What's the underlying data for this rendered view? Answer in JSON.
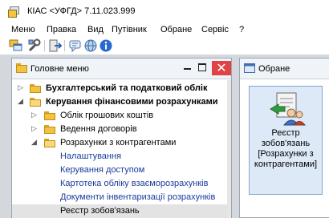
{
  "window": {
    "title": "КІАС <УФГД> 7.11.023.999"
  },
  "menubar": {
    "items": [
      "Меню",
      "Правка",
      "Вид",
      "Путівник",
      "Обране",
      "Сервіс",
      "?"
    ]
  },
  "toolbar": {
    "buttons": [
      "windows-icon",
      "tools-icon",
      "exit-icon",
      "chat-icon",
      "network-icon",
      "info-icon"
    ]
  },
  "main_menu_window": {
    "title": "Головне меню",
    "close_symbol": "✕",
    "tree": [
      {
        "label": "Бухгалтерський та податковий облік",
        "level": 0,
        "expander": "collapsed",
        "style": "bold"
      },
      {
        "label": "Керування фінансовими розрахунками",
        "level": 0,
        "expander": "expanded",
        "style": "bold"
      },
      {
        "label": "Облік грошових коштів",
        "level": 1,
        "expander": "collapsed",
        "style": "normal"
      },
      {
        "label": "Ведення договорів",
        "level": 1,
        "expander": "collapsed",
        "style": "normal"
      },
      {
        "label": "Розрахунки з контрагентами",
        "level": 1,
        "expander": "expanded",
        "style": "normal"
      },
      {
        "label": "Налаштування",
        "level": 2,
        "expander": "none",
        "style": "link"
      },
      {
        "label": "Керування доступом",
        "level": 2,
        "expander": "none",
        "style": "link"
      },
      {
        "label": "Картотека обліку взаєморозрахунків",
        "level": 2,
        "expander": "none",
        "style": "link"
      },
      {
        "label": "Документи інвентаризації розрахунків",
        "level": 2,
        "expander": "none",
        "style": "link"
      },
      {
        "label": "Реєстр зобов'язань",
        "level": 2,
        "expander": "none",
        "style": "selected"
      }
    ]
  },
  "favorites_window": {
    "title": "Обране",
    "tiles": [
      {
        "lines": [
          "Реєстр",
          "зобов'язань",
          "[Розрахунки з",
          "контрагентами]"
        ],
        "icon": "registry-people-icon"
      }
    ]
  },
  "colors": {
    "close_button": "#e04343",
    "link_text": "#1a3c9c",
    "tile_bg": "#dde9f6",
    "folder": "#f3c241"
  }
}
